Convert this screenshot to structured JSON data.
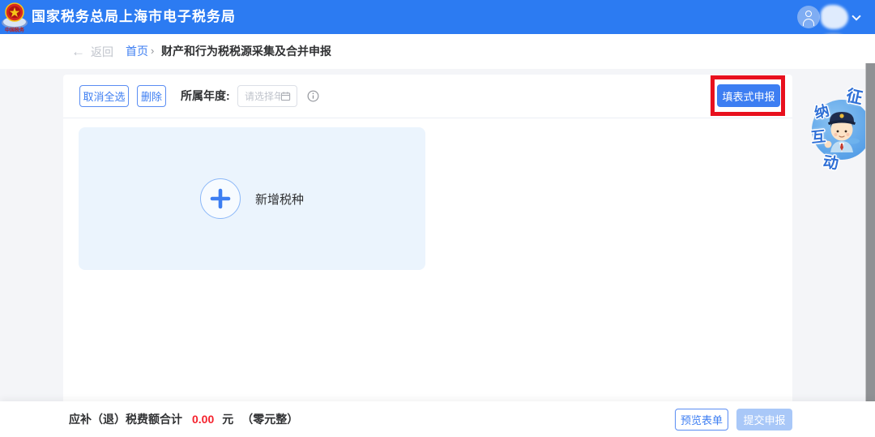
{
  "header": {
    "title": "国家税务总局上海市电子税务局",
    "logo_name": "china-tax-emblem"
  },
  "breadcrumb": {
    "back_arrow": "←",
    "back_label": "返回",
    "home": "首页",
    "separator": "›",
    "current": "财产和行为税税源采集及合并申报"
  },
  "toolbar": {
    "cancel_select_all": "取消全选",
    "delete": "删除",
    "year_label": "所属年度:",
    "year_placeholder": "请选择年份",
    "year_value": "",
    "fill_form_declare": "填表式申报"
  },
  "panel": {
    "plus": "+",
    "add_tax_label": "新增税种"
  },
  "mascot": {
    "chars": [
      "征",
      "纳",
      "互",
      "动"
    ]
  },
  "footer": {
    "total_label": "应补（退）税费额合计",
    "amount": "0.00",
    "unit": "元",
    "amount_words": "（零元整）",
    "preview_button": "预览表单",
    "submit_button": "提交申报"
  },
  "colors": {
    "header_bg": "#2C7BF2",
    "primary_blue": "#3D7EF2",
    "annotation_red": "#E8101E",
    "panel_blue": "#EBF4FD",
    "amount_red": "#F5222D",
    "disabled_submit": "#A9C8F8",
    "page_gray": "#F4F5F8"
  }
}
